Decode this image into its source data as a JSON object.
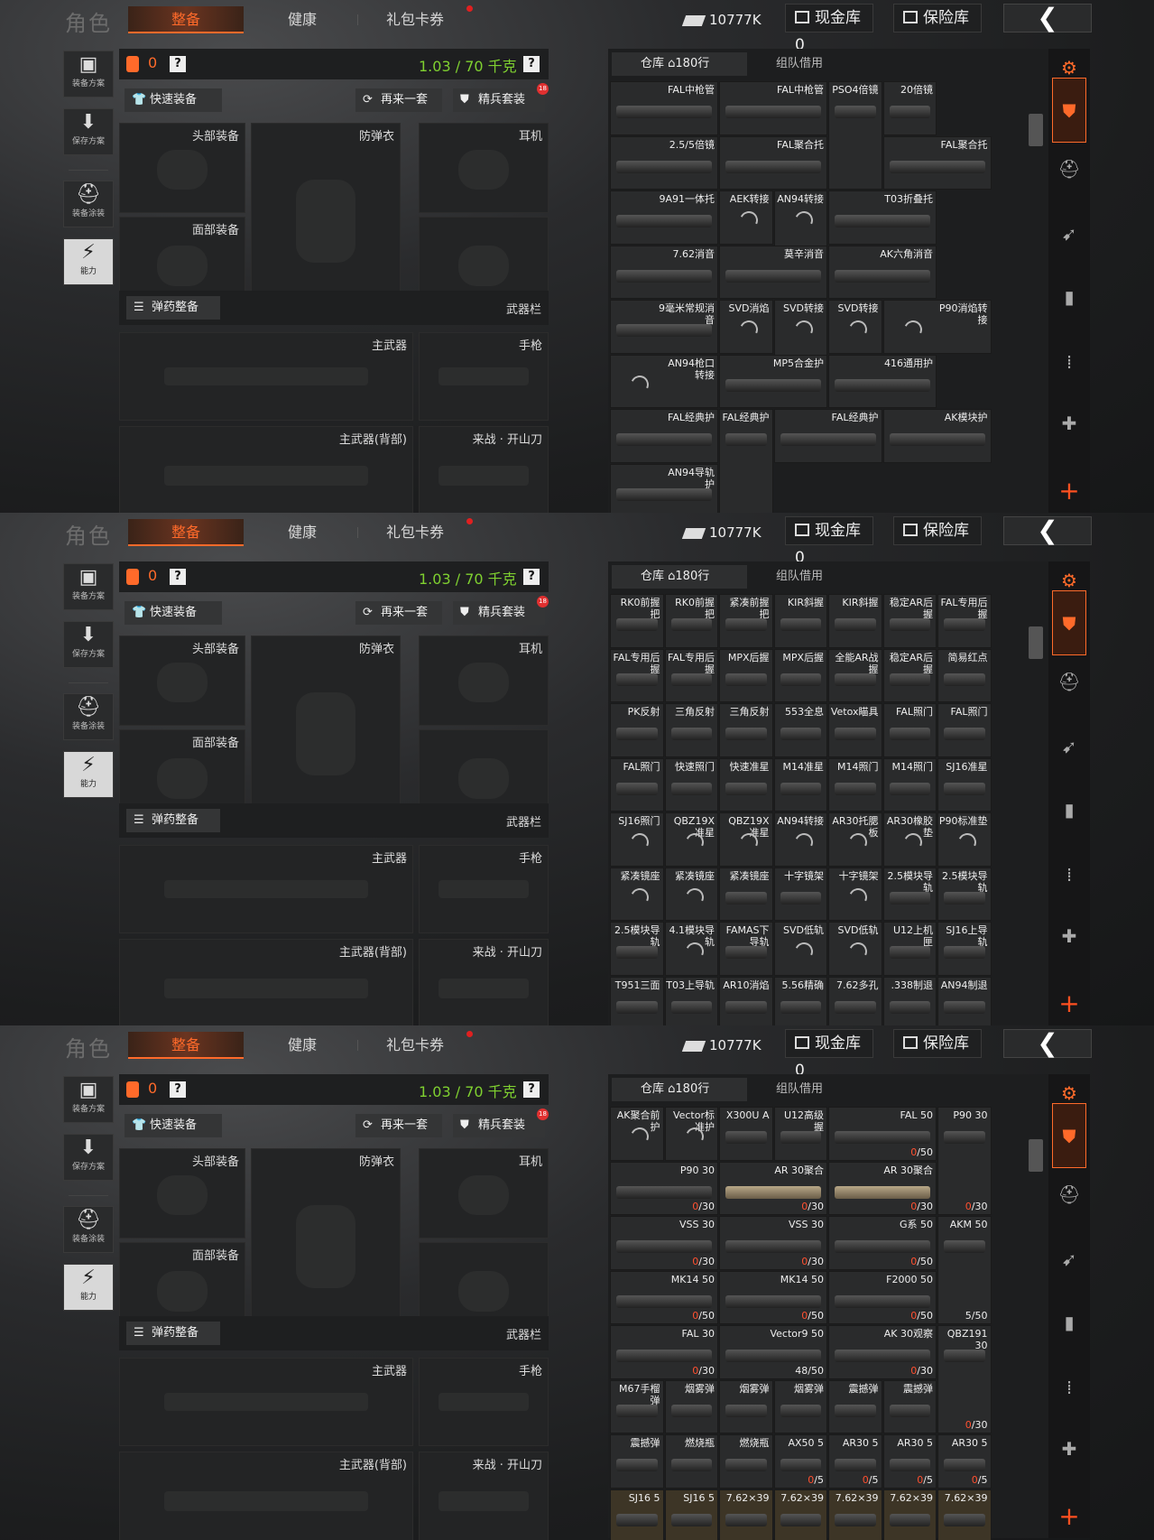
{
  "header": {
    "role": "角色",
    "tabs": [
      "整备",
      "健康",
      "礼包卡券"
    ],
    "money": "10777K",
    "cash_vault": "现金库 0",
    "safe_vault": "保险库"
  },
  "sidebar": [
    "装备方案",
    "保存方案",
    "装备涂装",
    "能力"
  ],
  "loadout": {
    "bag_count": "0",
    "weight": "1.03 / 70 千克",
    "quick_equip": "快速装备",
    "again": "再来一套",
    "elite": "精兵套装",
    "elite_badge": "18",
    "head": "头部装备",
    "armor": "防弹衣",
    "ear": "耳机",
    "face": "面部装备",
    "ammo": "弹药整备",
    "weapon_bar": "武器栏",
    "primary": "主武器",
    "pistol": "手枪",
    "primary_back": "主武器(背部)",
    "melee": "来战 · 开山刀"
  },
  "storage": {
    "tab_warehouse": "仓库",
    "rows": "180行",
    "tab_borrow": "组队借用"
  },
  "panels": [
    {
      "cells": [
        {
          "n": "FAL中枪管",
          "w": 2
        },
        {
          "n": "FAL中枪管",
          "w": 2
        },
        {
          "n": "PSO4倍镜",
          "h": 2
        },
        {
          "n": "20倍镜"
        },
        {
          "n": "2.5/5倍镜",
          "w": 2
        },
        {
          "n": "FAL聚合托",
          "w": 2
        },
        {
          "n": "FAL聚合托",
          "w": 2
        },
        {
          "n": "9A91一体托",
          "w": 2
        },
        {
          "n": "AEK转接",
          "s": 1
        },
        {
          "n": "AN94转接",
          "s": 1,
          "h": 2
        },
        {
          "n": "T03折叠托",
          "w": 2
        },
        {
          "n": "7.62消音",
          "w": 2
        },
        {
          "n": "莫辛消音",
          "w": 2
        },
        {
          "n": "AK六角消音",
          "w": 2
        },
        {
          "n": "9毫米常规消音",
          "w": 2
        },
        {
          "n": "SVD消焰",
          "s": 1
        },
        {
          "n": "SVD转接",
          "s": 1,
          "h": 2
        },
        {
          "n": "SVD转接",
          "s": 1
        },
        {
          "n": "P90消焰转接",
          "s": 1,
          "w": 2
        },
        {
          "n": "AN94枪口转接",
          "s": 1,
          "w": 2
        },
        {
          "n": "MP5合金护",
          "w": 2
        },
        {
          "n": "416通用护",
          "w": 2
        },
        {
          "n": "FAL经典护",
          "w": 2
        },
        {
          "n": "FAL经典护",
          "h": 2
        },
        {
          "n": "FAL经典护",
          "w": 2
        },
        {
          "n": "AK模块护",
          "w": 2
        },
        {
          "n": "AN94导轨护",
          "w": 2
        }
      ]
    },
    {
      "cells": [
        {
          "n": "RK0前握把"
        },
        {
          "n": "RK0前握把"
        },
        {
          "n": "紧凑前握把"
        },
        {
          "n": "KIR斜握"
        },
        {
          "n": "KIR斜握"
        },
        {
          "n": "稳定AR后握"
        },
        {
          "n": "FAL专用后握"
        },
        {
          "n": "FAL专用后握"
        },
        {
          "n": "FAL专用后握"
        },
        {
          "n": "MPX后握"
        },
        {
          "n": "MPX后握"
        },
        {
          "n": "全能AR战握"
        },
        {
          "n": "稳定AR后握"
        },
        {
          "n": "简易红点"
        },
        {
          "n": "PK反射"
        },
        {
          "n": "三角反射"
        },
        {
          "n": "三角反射"
        },
        {
          "n": "553全息"
        },
        {
          "n": "Vetox瞄具"
        },
        {
          "n": "FAL照门"
        },
        {
          "n": "FAL照门"
        },
        {
          "n": "FAL照门"
        },
        {
          "n": "快速照门"
        },
        {
          "n": "快速准星"
        },
        {
          "n": "M14准星"
        },
        {
          "n": "M14照门"
        },
        {
          "n": "M14照门"
        },
        {
          "n": "SJ16准星"
        },
        {
          "n": "SJ16照门",
          "s": 1
        },
        {
          "n": "QBZ19X准星",
          "s": 1
        },
        {
          "n": "QBZ19X准星",
          "s": 1
        },
        {
          "n": "AN94转接",
          "s": 1
        },
        {
          "n": "AR30托腮板",
          "s": 1
        },
        {
          "n": "AR30橡胶垫",
          "s": 1
        },
        {
          "n": "P90标准垫",
          "s": 1
        },
        {
          "n": "紧凑镜座",
          "s": 1
        },
        {
          "n": "紧凑镜座",
          "s": 1
        },
        {
          "n": "紧凑镜座"
        },
        {
          "n": "十字镜架"
        },
        {
          "n": "十字镜架",
          "s": 1
        },
        {
          "n": "2.5模块导轨"
        },
        {
          "n": "2.5模块导轨"
        },
        {
          "n": "2.5模块导轨"
        },
        {
          "n": "4.1模块导轨",
          "s": 1
        },
        {
          "n": "FAMAS下导轨"
        },
        {
          "n": "SVD低轨",
          "s": 1
        },
        {
          "n": "SVD低轨",
          "s": 1
        },
        {
          "n": "U12上机匣"
        },
        {
          "n": "SJ16上导轨"
        },
        {
          "n": "T951三面"
        },
        {
          "n": "T03上导轨"
        },
        {
          "n": "AR10消焰"
        },
        {
          "n": "5.56精确"
        },
        {
          "n": "7.62多孔"
        },
        {
          "n": ".338制退"
        },
        {
          "n": "AN94制退"
        }
      ]
    },
    {
      "cells": [
        {
          "n": "AK聚合前护",
          "s": 1
        },
        {
          "n": "Vector标准护",
          "s": 1
        },
        {
          "n": "X300U A"
        },
        {
          "n": "U12高级握"
        },
        {
          "n": "FAL 50",
          "c": "0/50",
          "w": 2
        },
        {
          "n": "P90 30",
          "c": "0/30",
          "h": 2
        },
        {
          "n": "P90 30",
          "c": "0/30",
          "w": 2
        },
        {
          "n": "AR 30聚合",
          "c": "0/30",
          "w": 2,
          "t": 1
        },
        {
          "n": "AR 30聚合",
          "c": "0/30",
          "w": 2,
          "t": 1
        },
        {
          "n": "VSS 30",
          "c": "0/30",
          "w": 2
        },
        {
          "n": "VSS 30",
          "c": "0/30",
          "w": 2
        },
        {
          "n": "G系 50",
          "c": "0/50",
          "w": 2
        },
        {
          "n": "AKM 50",
          "c": "5/50",
          "h": 2
        },
        {
          "n": "MK14 50",
          "c": "0/50",
          "w": 2
        },
        {
          "n": "MK14 50",
          "c": "0/50",
          "w": 2
        },
        {
          "n": "F2000 50",
          "c": "0/50",
          "w": 2
        },
        {
          "n": "FAL 30",
          "c": "0/30",
          "w": 2
        },
        {
          "n": "Vector9 50",
          "c": "48/50",
          "w": 2
        },
        {
          "n": "AK 30观察",
          "c": "0/30",
          "w": 2
        },
        {
          "n": "QBZ191 30",
          "c": "0/30",
          "h": 2
        },
        {
          "n": "M67手榴弹"
        },
        {
          "n": "烟雾弹"
        },
        {
          "n": "烟雾弹"
        },
        {
          "n": "烟雾弹"
        },
        {
          "n": "震撼弹"
        },
        {
          "n": "震撼弹"
        },
        {
          "n": "震撼弹"
        },
        {
          "n": "燃烧瓶"
        },
        {
          "n": "燃烧瓶"
        },
        {
          "n": "AX50 5",
          "c": "0/5"
        },
        {
          "n": "AR30 5",
          "c": "0/5"
        },
        {
          "n": "AR30 5",
          "c": "0/5"
        },
        {
          "n": "AR30 5",
          "c": "0/5"
        },
        {
          "n": "SJ16 5",
          "g": 1
        },
        {
          "n": "SJ16 5",
          "g": 1
        },
        {
          "n": "7.62×39",
          "g": 1
        },
        {
          "n": "7.62×39",
          "g": 1
        },
        {
          "n": "7.62×39",
          "g": 1
        },
        {
          "n": "7.62×39",
          "g": 1
        },
        {
          "n": "7.62×39",
          "g": 1
        }
      ]
    }
  ]
}
